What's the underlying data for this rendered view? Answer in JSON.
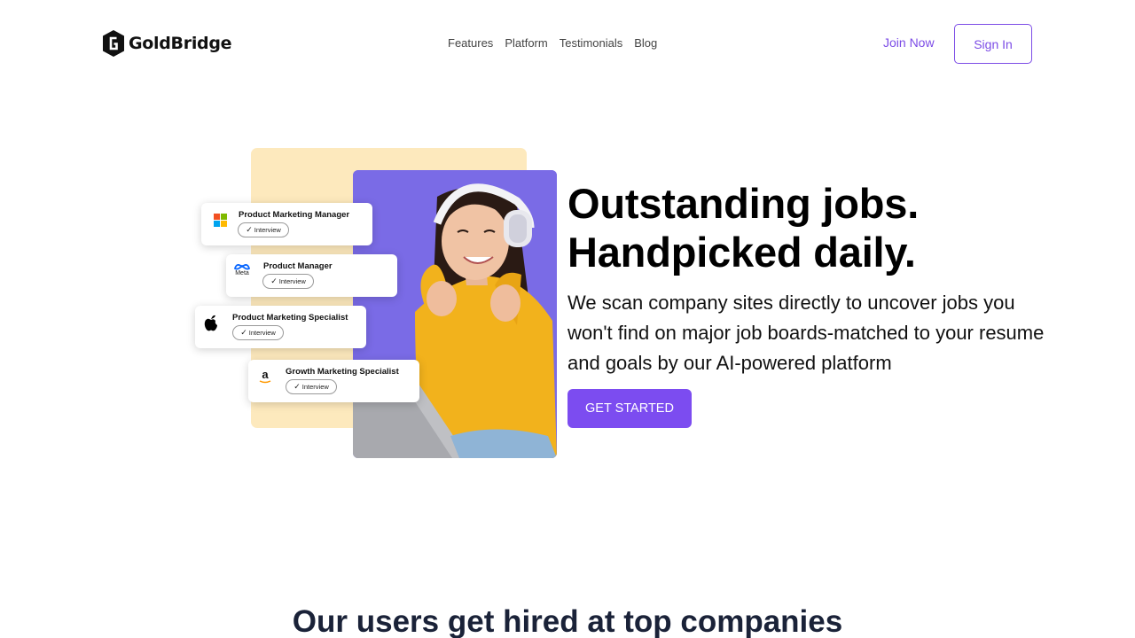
{
  "brand": {
    "name": "GoldBridge",
    "accent": "#7c4ce6"
  },
  "nav": {
    "items": [
      "Features",
      "Platform",
      "Testimonials",
      "Blog"
    ]
  },
  "header": {
    "join_label": "Join Now",
    "signin_label": "Sign In"
  },
  "hero": {
    "headline_line1": "Outstanding jobs.",
    "headline_line2": "Handpicked daily.",
    "subtext": "We scan company sites directly to uncover jobs you won't find on major job boards-matched to your resume and goals by our AI-powered platform",
    "cta_label": "GET STARTED"
  },
  "job_cards": [
    {
      "title": "Product Marketing Manager",
      "status": "Interview",
      "company_icon": "microsoft-icon"
    },
    {
      "title": "Product Manager",
      "status": "Interview",
      "company_icon": "meta-icon",
      "company_label": "Meta"
    },
    {
      "title": "Product Marketing Specialist",
      "status": "Interview",
      "company_icon": "apple-icon"
    },
    {
      "title": "Growth Marketing Specialist",
      "status": "Interview",
      "company_icon": "amazon-icon"
    }
  ],
  "companies_section": {
    "title": "Our users get hired at top companies"
  }
}
